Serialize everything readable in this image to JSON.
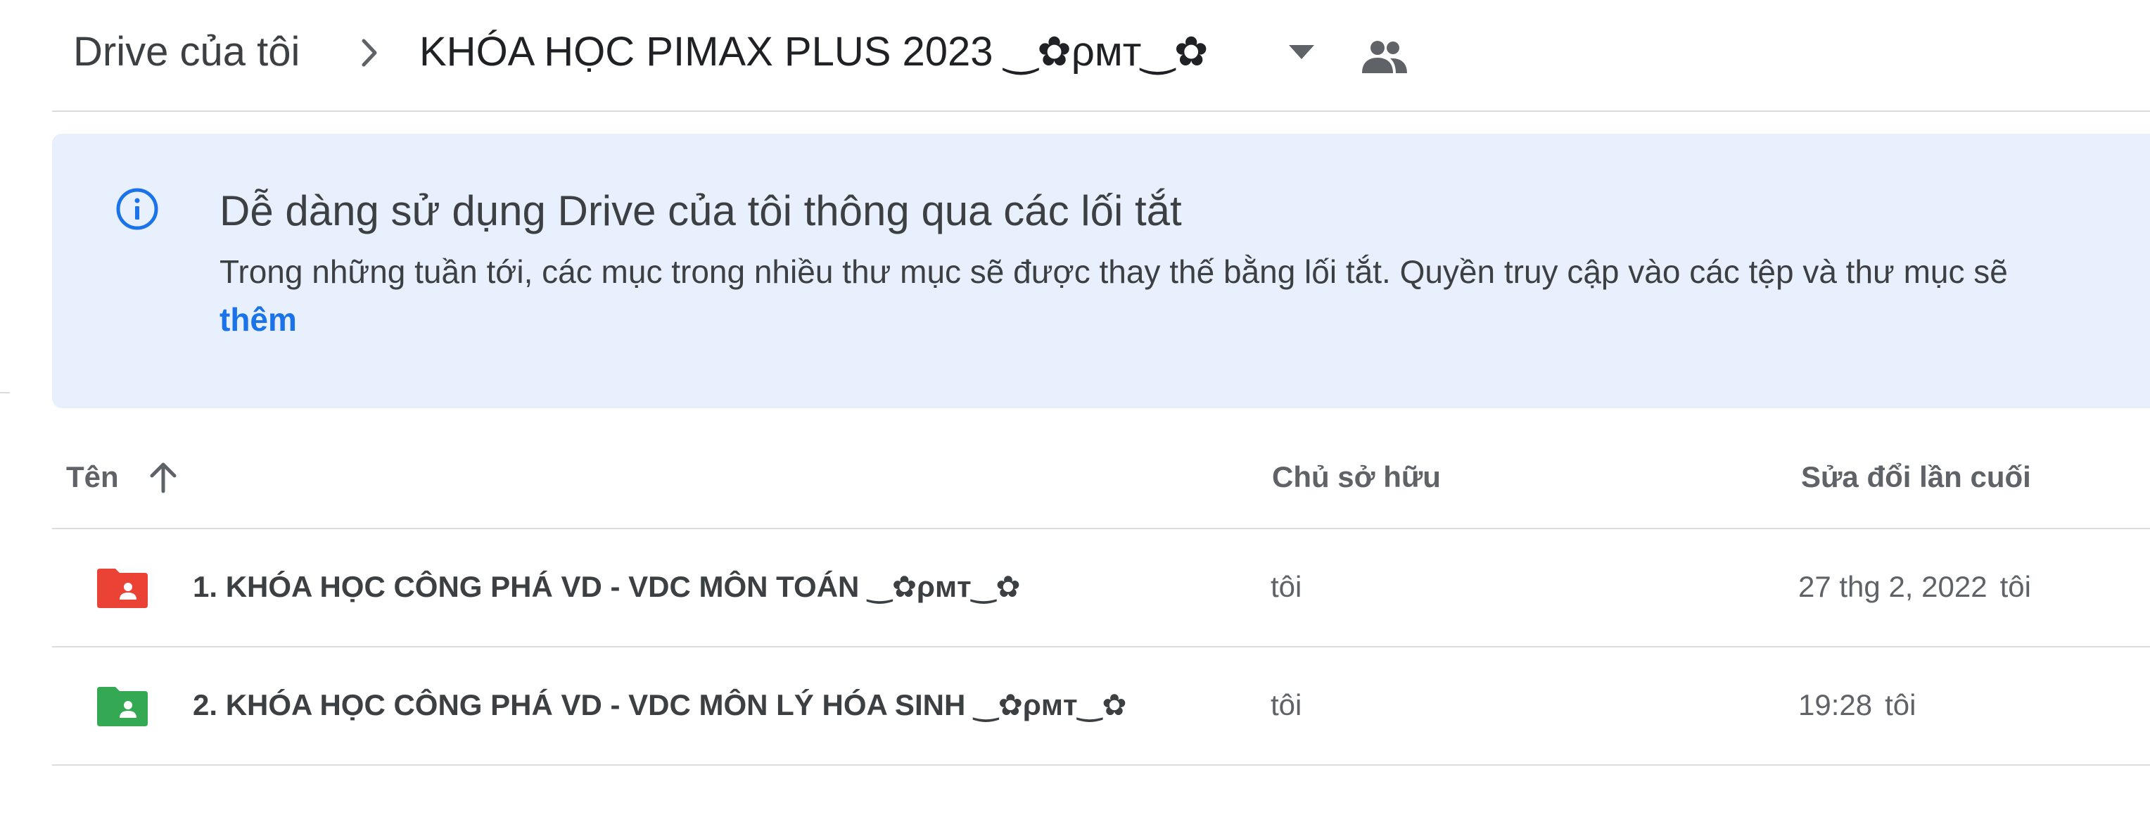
{
  "breadcrumb": {
    "root_label": "Drive của tôi",
    "current_folder": "KHÓA HỌC PIMAX PLUS 2023 ‿✿ρмт‿✿"
  },
  "banner": {
    "title": "Dễ dàng sử dụng Drive của tôi thông qua các lối tắt",
    "body": "Trong những tuần tới, các mục trong nhiều thư mục sẽ được thay thế bằng lối tắt. Quyền truy cập vào các tệp và thư mục sẽ",
    "link_label": "thêm"
  },
  "table": {
    "columns": {
      "name": "Tên",
      "owner": "Chủ sở hữu",
      "modified": "Sửa đổi lần cuối"
    },
    "rows": [
      {
        "name": "1. KHÓA HỌC CÔNG PHÁ VD - VDC MÔN TOÁN ‿✿ρмт‿✿",
        "owner": "tôi",
        "modified_date": "27 thg 2, 2022",
        "modified_by": "tôi",
        "folder_color": "#ea4335"
      },
      {
        "name": "2. KHÓA HỌC CÔNG PHÁ VD - VDC MÔN LÝ HÓA SINH ‿✿ρмт‿✿",
        "owner": "tôi",
        "modified_date": "19:28",
        "modified_by": "tôi",
        "folder_color": "#34a853"
      }
    ]
  },
  "icons": {
    "breadcrumb_separator": "chevron-right-icon",
    "dropdown": "caret-down-icon",
    "shared": "people-icon",
    "info": "info-icon",
    "sort": "arrow-up-icon",
    "folder": "shared-folder-icon"
  },
  "colors": {
    "accent": "#1a73e8",
    "banner_bg": "#e8f0fe"
  }
}
